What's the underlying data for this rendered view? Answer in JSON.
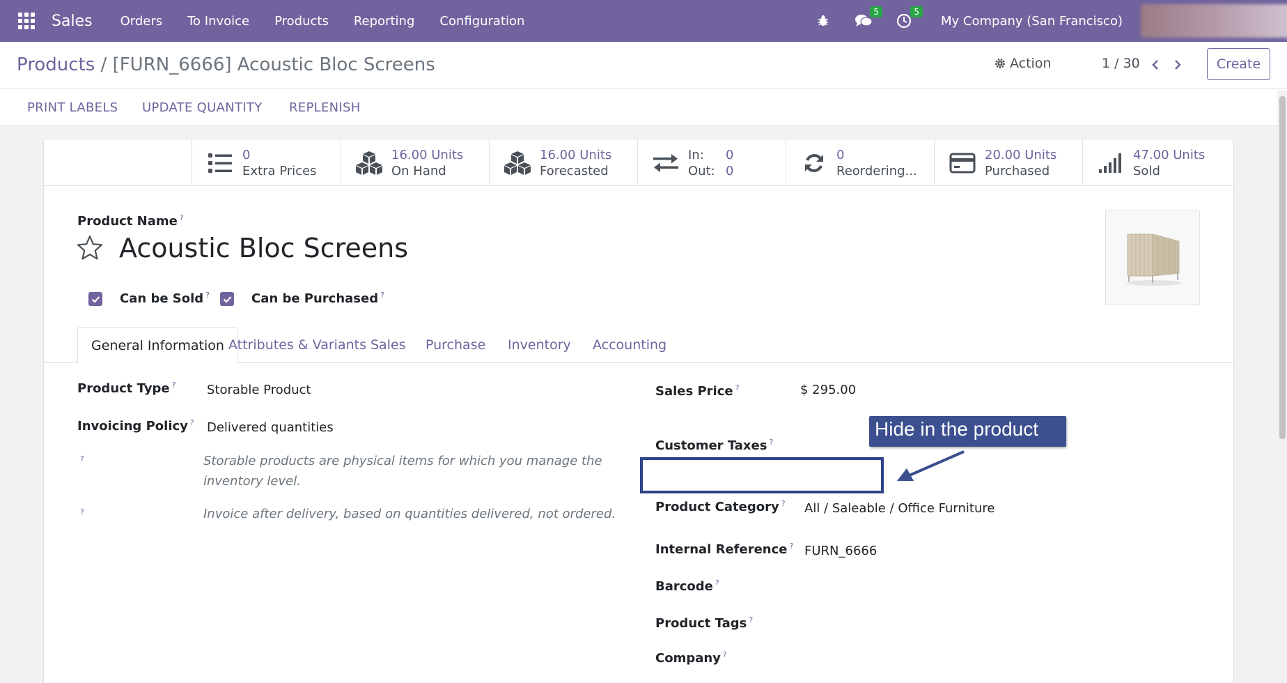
{
  "navbar": {
    "brand": "Sales",
    "menu": [
      "Orders",
      "To Invoice",
      "Products",
      "Reporting",
      "Configuration"
    ],
    "messages_count": "5",
    "activities_count": "5",
    "company": "My Company (San Francisco)"
  },
  "control_panel": {
    "breadcrumb_root": "Products",
    "breadcrumb_sep": "/",
    "breadcrumb_current": "[FURN_6666] Acoustic Bloc Screens",
    "action_label": "Action",
    "pager": "1 / 30",
    "create_label": "Create"
  },
  "statusbar": {
    "buttons": [
      "PRINT LABELS",
      "UPDATE QUANTITY",
      "REPLENISH"
    ]
  },
  "smart_buttons": {
    "extra_prices": {
      "value": "0",
      "label": "Extra Prices"
    },
    "on_hand": {
      "value": "16.00 Units",
      "label": "On Hand"
    },
    "forecasted": {
      "value": "16.00 Units",
      "label": "Forecasted"
    },
    "in_out": {
      "in_label": "In:",
      "in_value": "0",
      "out_label": "Out:",
      "out_value": "0"
    },
    "reordering": {
      "value": "0",
      "label": "Reordering..."
    },
    "purchased": {
      "value": "20.00 Units",
      "label": "Purchased"
    },
    "sold": {
      "value": "47.00 Units",
      "label": "Sold"
    }
  },
  "form": {
    "product_name_label": "Product Name",
    "product_name": "Acoustic Bloc Screens",
    "can_be_sold": "Can be Sold",
    "can_be_purchased": "Can be Purchased",
    "help_mark": "?",
    "tabs": [
      "General Information",
      "Attributes & Variants",
      "Sales",
      "Purchase",
      "Inventory",
      "Accounting"
    ],
    "active_tab": "General Information",
    "left": {
      "product_type_label": "Product Type",
      "product_type": "Storable Product",
      "invoicing_policy_label": "Invoicing Policy",
      "invoicing_policy": "Delivered quantities",
      "help_storable": "Storable products are physical items for which you manage the inventory level.",
      "help_invoice": "Invoice after delivery, based on quantities delivered, not ordered."
    },
    "right": {
      "sales_price_label": "Sales Price",
      "sales_price": "$ 295.00",
      "customer_taxes_label": "Customer Taxes",
      "product_category_label": "Product Category",
      "product_category": "All / Saleable / Office Furniture",
      "internal_reference_label": "Internal Reference",
      "internal_reference": "FURN_6666",
      "barcode_label": "Barcode",
      "product_tags_label": "Product Tags",
      "company_label": "Company"
    }
  },
  "annotation": {
    "callout_text": "Hide in the product"
  },
  "colors": {
    "brand": "#71639e",
    "badge": "#28a745",
    "annotation": "#3c4f8f"
  }
}
